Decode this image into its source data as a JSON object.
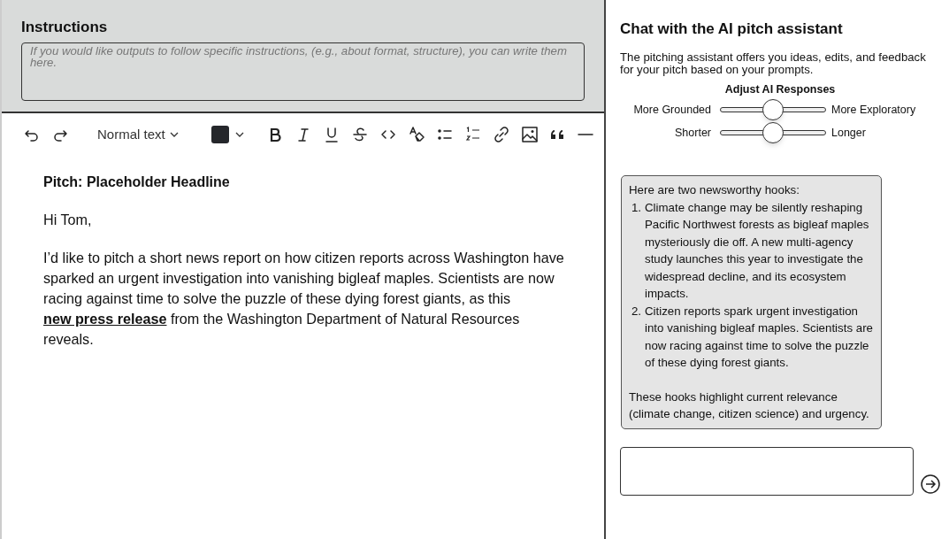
{
  "instructions": {
    "title": "Instructions",
    "placeholder": "If you would like outputs to follow specific instructions, (e.g., about format, structure), you can write them here."
  },
  "toolbar": {
    "tools": [
      {
        "kind": "undo"
      },
      {
        "kind": "redo"
      },
      {
        "kind": "style",
        "label": "Normal text"
      },
      {
        "kind": "color",
        "color": "#25272b"
      },
      {
        "kind": "bold"
      },
      {
        "kind": "italic"
      },
      {
        "kind": "underline"
      },
      {
        "kind": "strike"
      },
      {
        "kind": "code"
      },
      {
        "kind": "clear"
      },
      {
        "kind": "bullets"
      },
      {
        "kind": "numbers"
      },
      {
        "kind": "link"
      },
      {
        "kind": "image"
      },
      {
        "kind": "quote"
      },
      {
        "kind": "rule"
      }
    ]
  },
  "document": {
    "title": "Pitch: Placeholder Headline",
    "greeting": "Hi Tom,",
    "paragraph": {
      "before": "I’d like to pitch a short news report on how citizen reports across Washington have sparked an urgent investigation into vanishing bigleaf maples. Scientists are now racing against time to solve the puzzle of these dying forest giants, as this",
      "link": "new press release",
      "after": "from the Washington Department of Natural Resources reveals."
    }
  },
  "chat": {
    "title": "Chat with the AI pitch assistant",
    "description": "The pitching assistant offers you ideas, edits, and feedback for your pitch based on your prompts.",
    "adjust_title": "Adjust AI Responses",
    "sliders": [
      {
        "left": "More Grounded",
        "right": "More Exploratory",
        "level": 0.5
      },
      {
        "left": "Shorter",
        "right": "Longer",
        "level": 0.5
      }
    ],
    "message": {
      "intro": "Here are two newsworthy hooks:",
      "items": [
        {
          "marker": "1.",
          "text": "Climate change may be silently reshaping Pacific Northwest forests as bigleaf maples mysteriously die off. A new multi-agency study launches this year to investigate the widespread decline, and its ecosystem impacts."
        },
        {
          "marker": "2.",
          "text": "Citizen reports spark urgent investigation into vanishing bigleaf maples. Scientists are now racing against time to solve the puzzle of these dying forest giants."
        }
      ],
      "outro": "These hooks highlight current relevance (climate change, citizen science) and urgency."
    }
  }
}
